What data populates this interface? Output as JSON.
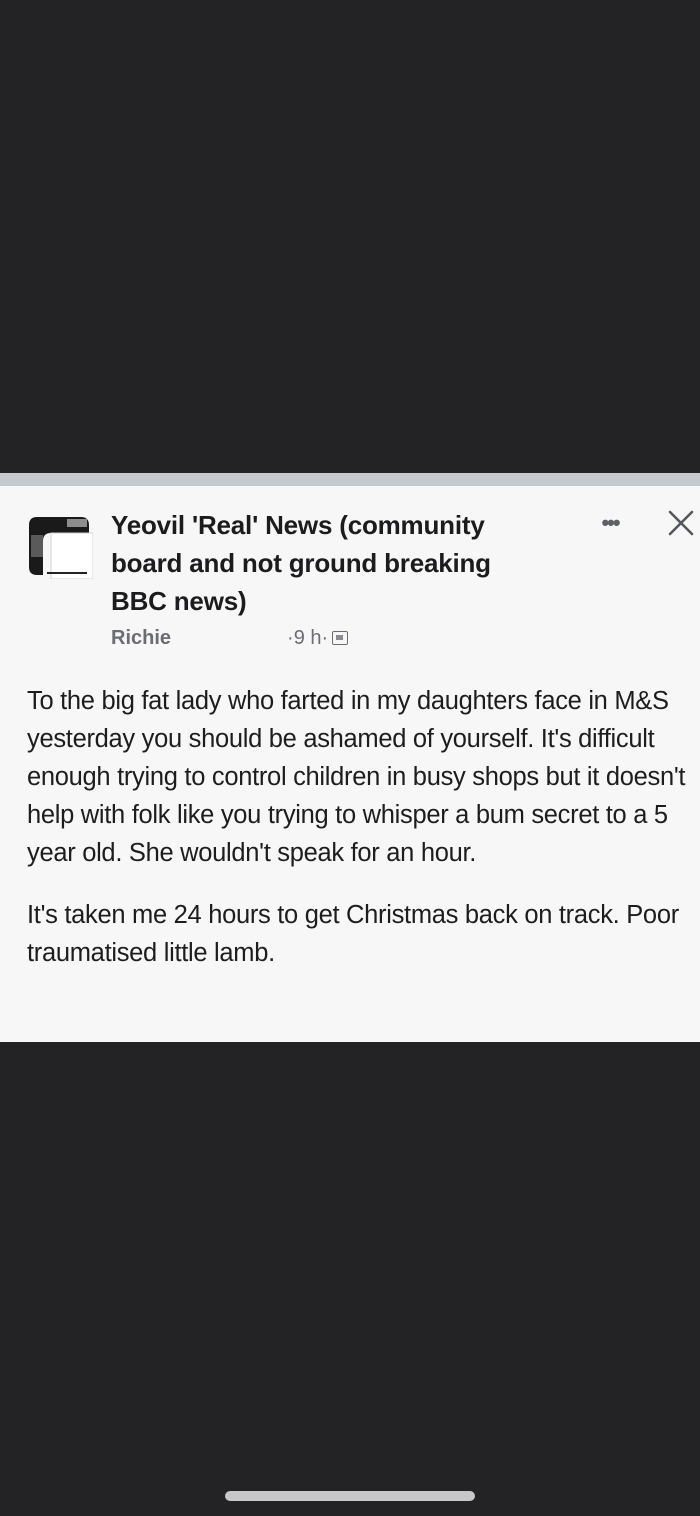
{
  "post": {
    "group_name": "Yeovil 'Real' News (community board and not ground breaking BBC news)",
    "author": "Richie",
    "timestamp": "9 h",
    "separator": "·",
    "more_icon": "more-dots-icon",
    "close_icon": "close-icon",
    "privacy_icon": "group-privacy-icon",
    "paragraphs": [
      "To the big fat lady who farted in my daughters face in M&S yesterday you should be ashamed of yourself. It's difficult enough trying to control children in busy shops but it doesn't help with folk like you trying to whisper a bum secret to a 5 year old. She wouldn't speak for an hour.",
      "It's taken me 24 hours to get Christmas back on track. Poor traumatised little lamb."
    ]
  },
  "more_label": "•••",
  "colors": {
    "background": "#232325",
    "card": "#f7f7f7",
    "text": "#1d1d1f",
    "meta": "#6b6d72"
  }
}
